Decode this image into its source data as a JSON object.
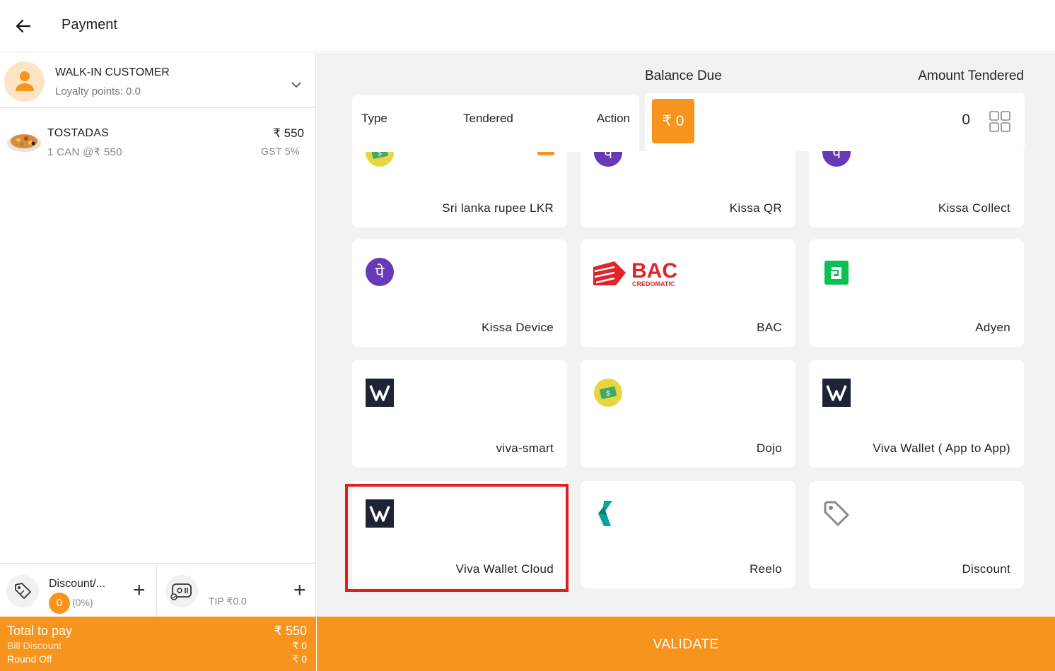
{
  "header": {
    "title": "Payment"
  },
  "customer": {
    "name": "WALK-IN CUSTOMER",
    "loyalty": "Loyalty points: 0.0"
  },
  "order": {
    "items": [
      {
        "name": "TOSTADAS",
        "detail": "1 CAN @₹ 550",
        "price": "₹ 550",
        "tax": "GST 5%"
      }
    ]
  },
  "discount": {
    "label": "Discount/...",
    "count": "0",
    "percent": "(0%)"
  },
  "tip": {
    "label": "TIP ₹0.0"
  },
  "totals": {
    "total_label": "Total to pay",
    "total_value": "₹ 550",
    "bill_discount_label": "Bill Discount",
    "bill_discount_value": "₹ 0",
    "round_off_label": "Round Off",
    "round_off_value": "₹ 0"
  },
  "payment": {
    "balance_due_label": "Balance Due",
    "amount_tendered_label": "Amount Tendered",
    "balance_due_value": "₹ 0",
    "amount_tendered_value": "0",
    "table_headers": {
      "type": "Type",
      "tendered": "Tendered",
      "action": "Action"
    }
  },
  "methods": [
    {
      "label": "Sri lanka rupee LKR",
      "icon": "money-icon"
    },
    {
      "label": "Kissa QR",
      "icon": "phonepe-icon"
    },
    {
      "label": "Kissa Collect",
      "icon": "phonepe-icon"
    },
    {
      "label": "Kissa Device",
      "icon": "phonepe-icon"
    },
    {
      "label": "BAC",
      "icon": "bac-logo",
      "logo_text": "BAC",
      "logo_sub": "CREDOMATIC"
    },
    {
      "label": "Adyen",
      "icon": "adyen-icon"
    },
    {
      "label": "viva-smart",
      "icon": "viva-wallet-icon"
    },
    {
      "label": "Dojo",
      "icon": "money-icon"
    },
    {
      "label": "Viva Wallet ( App to App)",
      "icon": "viva-wallet-icon"
    },
    {
      "label": "Viva Wallet Cloud",
      "icon": "viva-wallet-icon",
      "selected": true
    },
    {
      "label": "Reelo",
      "icon": "reelo-icon"
    },
    {
      "label": "Discount",
      "icon": "tag-icon"
    }
  ],
  "validate_label": "VALIDATE",
  "colors": {
    "accent": "#f7941d",
    "selection": "#e02020",
    "phonepe": "#6739b7",
    "viva": "#1f2336",
    "adyen": "#0abf53",
    "bac": "#e1242b",
    "reelo": "#0aa39a"
  }
}
